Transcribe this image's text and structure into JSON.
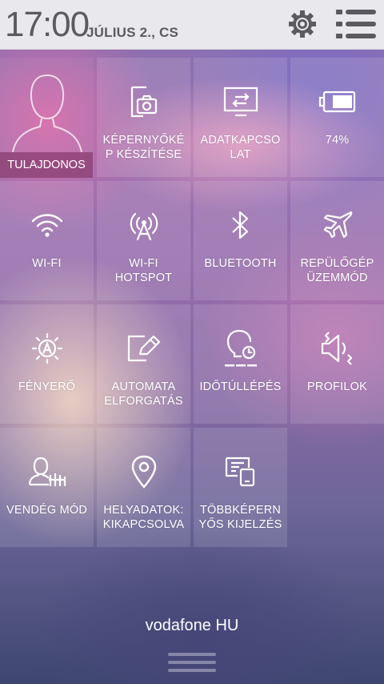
{
  "status_bar": {
    "time": "17:00",
    "date": "JÚLIUS 2., CS",
    "settings_icon": "gear-icon",
    "menu_icon": "list-menu-icon"
  },
  "tiles": [
    {
      "id": "owner",
      "label": "TULAJDONOS",
      "icon": "user-silhouette-icon"
    },
    {
      "id": "screenshot",
      "label": "KÉPERNYŐKÉ\nP KÉSZÍTÉSE",
      "icon": "screenshot-icon"
    },
    {
      "id": "data",
      "label": "ADATKAPCSO\nLAT",
      "icon": "data-transfer-icon"
    },
    {
      "id": "battery",
      "label": "74%",
      "icon": "battery-icon"
    },
    {
      "id": "wifi",
      "label": "WI-FI",
      "icon": "wifi-icon"
    },
    {
      "id": "hotspot",
      "label": "WI-FI\nHOTSPOT",
      "icon": "hotspot-icon"
    },
    {
      "id": "bluetooth",
      "label": "BLUETOOTH",
      "icon": "bluetooth-icon"
    },
    {
      "id": "airplane",
      "label": "REPÜLŐGÉP\nÜZEMMÓD",
      "icon": "airplane-icon"
    },
    {
      "id": "brightness",
      "label": "FÉNYERŐ",
      "icon": "brightness-auto-icon"
    },
    {
      "id": "rotate",
      "label": "AUTOMATA\nELFORGATÁS",
      "icon": "auto-rotate-icon"
    },
    {
      "id": "timeout",
      "label": "IDŐTÚLLÉPÉS",
      "icon": "screen-timeout-icon"
    },
    {
      "id": "profiles",
      "label": "PROFILOK",
      "icon": "speaker-vibrate-icon"
    },
    {
      "id": "guest",
      "label": "VENDÉG MÓD",
      "icon": "guest-mode-icon"
    },
    {
      "id": "location",
      "label": "HELYADATOK:\nKIKAPCSOLVA",
      "icon": "location-pin-icon"
    },
    {
      "id": "multiscreen",
      "label": "TÖBBKÉPERN\nYŐS KIJELZÉS",
      "icon": "multiscreen-icon"
    }
  ],
  "battery_level": 0.74,
  "operator": "vodafone HU",
  "handle_icon": "drag-handle-icon"
}
